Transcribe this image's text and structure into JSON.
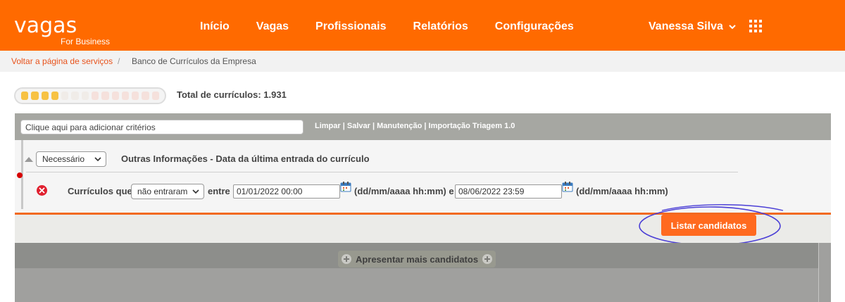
{
  "header": {
    "logo_main": "vagas",
    "logo_sub": "For Business",
    "nav": [
      "Início",
      "Vagas",
      "Profissionais",
      "Relatórios",
      "Configurações"
    ],
    "user_name": "Vanessa Silva",
    "brand_color": "#ff6a00"
  },
  "breadcrumb": {
    "back_link": "Voltar a página de serviços",
    "separator": "/",
    "current": "Banco de Currículos da Empresa"
  },
  "summary": {
    "total_label": "Total de currículos: 1.931",
    "progress_filled_segments": 4,
    "progress_total_segments": 14
  },
  "criteria_bar": {
    "placeholder": "Clique aqui para adicionar critérios",
    "links": [
      "Limpar",
      "Salvar",
      "Manutenção",
      "Importação Triagem 1.0"
    ],
    "link_separator": " | "
  },
  "criterion": {
    "requirement_selected": "Necessário",
    "title": "Outras Informações - Data da última entrada do currículo",
    "label_prefix": "Currículos que",
    "condition_selected": "não entraram",
    "between_label": "entre",
    "start_date": "01/01/2022 00:00",
    "format_hint_1": "(dd/mm/aaaa hh:mm) e",
    "end_date": "08/06/2022 23:59",
    "format_hint_2": "(dd/mm/aaaa hh:mm)"
  },
  "actions": {
    "list_button": "Listar candidatos",
    "more_button": "Apresentar mais candidatos"
  }
}
